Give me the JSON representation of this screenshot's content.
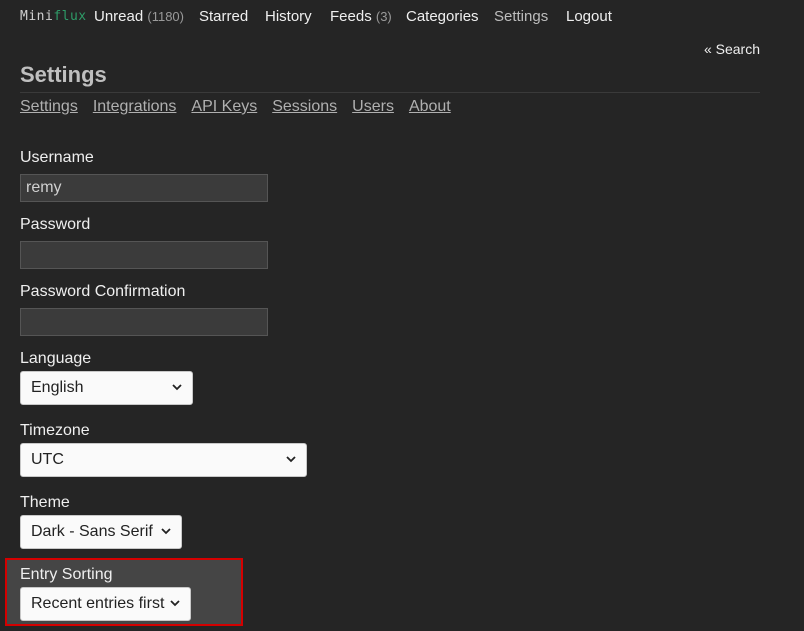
{
  "app": {
    "logo_mini": "Mini",
    "logo_flux": "flux"
  },
  "nav": {
    "unread": {
      "label": "Unread",
      "count": "(1180)"
    },
    "starred": {
      "label": "Starred"
    },
    "history": {
      "label": "History"
    },
    "feeds": {
      "label": "Feeds",
      "count": "(3)"
    },
    "categories": {
      "label": "Categories"
    },
    "settings": {
      "label": "Settings"
    },
    "logout": {
      "label": "Logout"
    }
  },
  "search_link": "« Search",
  "page": {
    "title": "Settings"
  },
  "subnav": {
    "settings": "Settings",
    "integrations": "Integrations",
    "api_keys": "API Keys",
    "sessions": "Sessions",
    "users": "Users",
    "about": "About"
  },
  "form": {
    "username": {
      "label": "Username",
      "value": "remy"
    },
    "password": {
      "label": "Password",
      "value": ""
    },
    "password_confirmation": {
      "label": "Password Confirmation",
      "value": ""
    },
    "language": {
      "label": "Language",
      "selected": "English"
    },
    "timezone": {
      "label": "Timezone",
      "selected": "UTC"
    },
    "theme": {
      "label": "Theme",
      "selected": "Dark - Sans Serif"
    },
    "entry_sorting": {
      "label": "Entry Sorting",
      "selected": "Recent entries first"
    }
  },
  "colors": {
    "background": "#252525",
    "accent": "#2e9c68",
    "highlight_border": "#d40000"
  }
}
